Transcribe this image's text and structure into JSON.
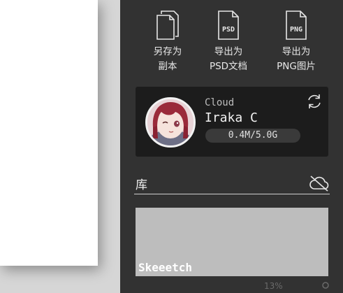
{
  "actions": [
    {
      "label": "另存为\n副本",
      "icon": "document-copy-icon"
    },
    {
      "label": "导出为\nPSD文档",
      "icon": "psd-file-icon",
      "badge": "PSD"
    },
    {
      "label": "导出为\nPNG图片",
      "icon": "png-file-icon",
      "badge": "PNG"
    }
  ],
  "account": {
    "service_label": "Cloud",
    "user_name": "Iraka C",
    "storage_text": "0.4M/5.0G",
    "storage_used_fraction": 0.0001
  },
  "library": {
    "title": "库",
    "items": [
      {
        "name": "Skeeetch"
      }
    ]
  },
  "footer": {
    "text": "13%"
  },
  "colors": {
    "panel_bg": "#323232",
    "card_bg": "#1c1c1c",
    "item_bg": "#bdbdbd",
    "canvas_bg": "#d6d6d6"
  }
}
